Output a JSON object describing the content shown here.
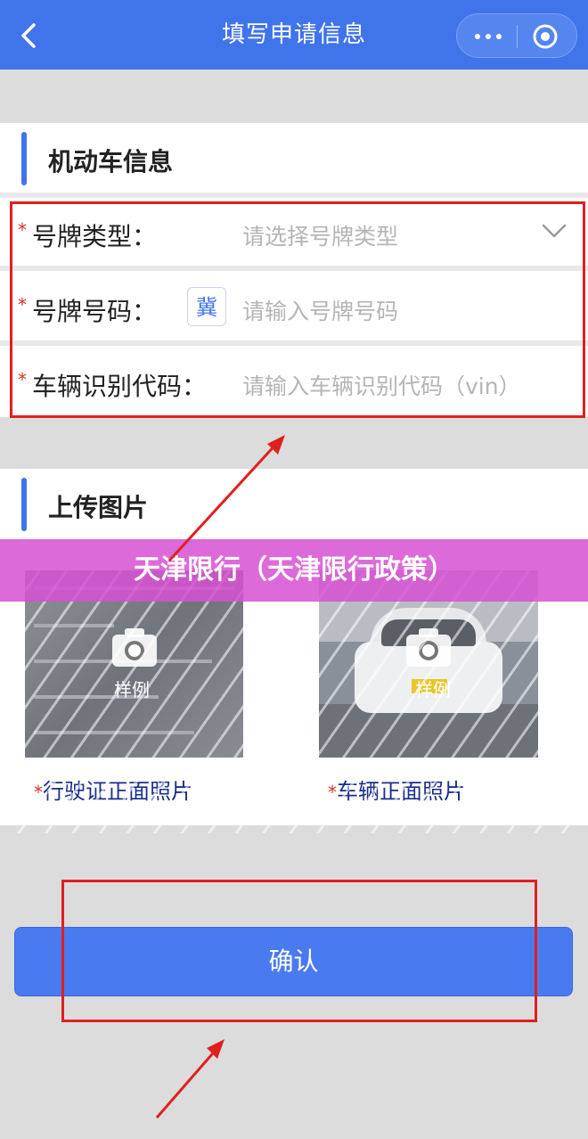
{
  "header": {
    "title": "填写申请信息",
    "back_icon": "chevron-left-icon",
    "more_icon": "more-dots-icon",
    "close_icon": "target-circle-icon",
    "color": "#3f74ea"
  },
  "vehicle_section": {
    "title": "机动车信息",
    "rows": [
      {
        "required": "*",
        "label": "号牌类型：",
        "placeholder": "请选择号牌类型"
      },
      {
        "required": "*",
        "label": "号牌号码：",
        "prefix": "冀",
        "placeholder": "请输入号牌号码"
      },
      {
        "required": "*",
        "label": "车辆识别代码：",
        "placeholder": "请输入车辆识别代码（vin）"
      }
    ]
  },
  "upload_section": {
    "title": "上传图片",
    "photos": [
      {
        "required": "*",
        "label": "行驶证正面照片",
        "sample": "样例"
      },
      {
        "required": "*",
        "label": "车辆正面照片",
        "sample": "样例"
      }
    ]
  },
  "banner": {
    "text": "天津限行（天津限行政策）"
  },
  "confirm": {
    "label": "确认"
  },
  "colors": {
    "accent": "#3f74ea",
    "highlight": "#e02020",
    "required": "#d9302c"
  }
}
